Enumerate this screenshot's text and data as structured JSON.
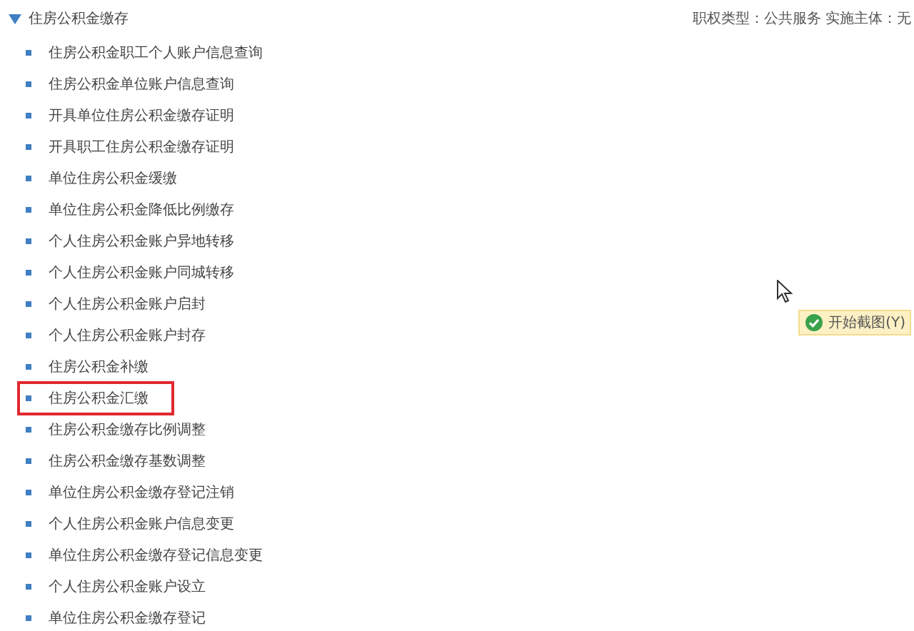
{
  "section": {
    "title": "住房公积金缴存",
    "expanded": true,
    "meta": "职权类型：公共服务 实施主体：无"
  },
  "items": [
    {
      "label": "住房公积金职工个人账户信息查询",
      "highlighted": false
    },
    {
      "label": "住房公积金单位账户信息查询",
      "highlighted": false
    },
    {
      "label": "开具单位住房公积金缴存证明",
      "highlighted": false
    },
    {
      "label": "开具职工住房公积金缴存证明",
      "highlighted": false
    },
    {
      "label": "单位住房公积金缓缴",
      "highlighted": false
    },
    {
      "label": "单位住房公积金降低比例缴存",
      "highlighted": false
    },
    {
      "label": "个人住房公积金账户异地转移",
      "highlighted": false
    },
    {
      "label": "个人住房公积金账户同城转移",
      "highlighted": false
    },
    {
      "label": "个人住房公积金账户启封",
      "highlighted": false
    },
    {
      "label": "个人住房公积金账户封存",
      "highlighted": false
    },
    {
      "label": "住房公积金补缴",
      "highlighted": false
    },
    {
      "label": "住房公积金汇缴",
      "highlighted": true
    },
    {
      "label": "住房公积金缴存比例调整",
      "highlighted": false
    },
    {
      "label": "住房公积金缴存基数调整",
      "highlighted": false
    },
    {
      "label": "单位住房公积金缴存登记注销",
      "highlighted": false
    },
    {
      "label": "个人住房公积金账户信息变更",
      "highlighted": false
    },
    {
      "label": "单位住房公积金缴存登记信息变更",
      "highlighted": false
    },
    {
      "label": "个人住房公积金账户设立",
      "highlighted": false
    },
    {
      "label": "单位住房公积金缴存登记",
      "highlighted": false
    }
  ],
  "tooltip": {
    "text": "开始截图(Y)"
  }
}
